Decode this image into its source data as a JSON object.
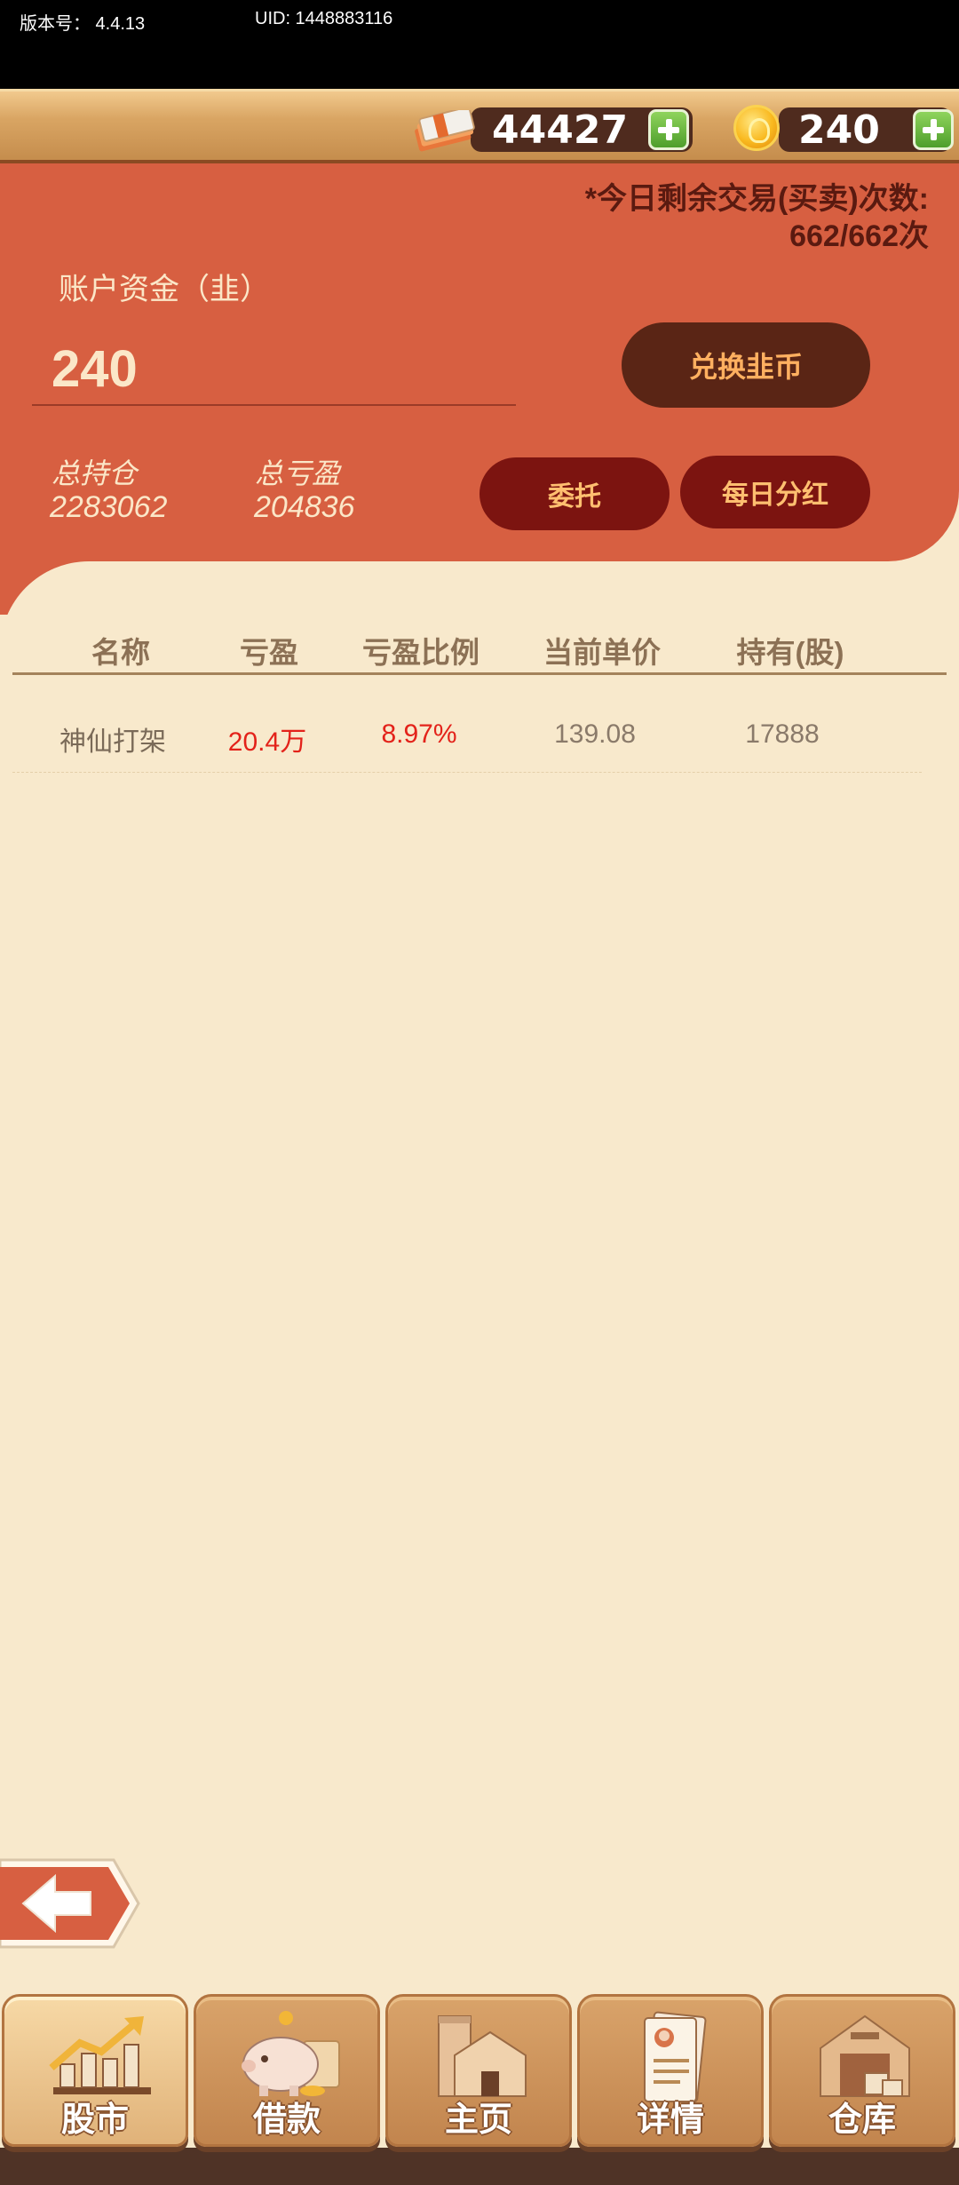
{
  "status": {
    "version": "版本号： 4.4.13",
    "uid": "UID: 1448883116"
  },
  "resources": {
    "cash": "44427",
    "coins": "240",
    "cash_icon": "cash-stack-icon",
    "coin_icon": "gold-coin-icon"
  },
  "account": {
    "trades_title": "*今日剩余交易(买卖)次数:",
    "trades_count": "662/662次",
    "fund_label": "账户资金（韭）",
    "fund_value": "240",
    "exchange_button": "兑换韭币",
    "total_position_label": "总持仓",
    "total_position_value": "2283062",
    "total_pnl_label": "总亏盈",
    "total_pnl_value": "204836",
    "entrust_button": "委托",
    "dividend_button": "每日分红"
  },
  "table": {
    "headers": [
      "名称",
      "亏盈",
      "亏盈比例",
      "当前单价",
      "持有(股)"
    ],
    "rows": [
      {
        "name": "神仙打架",
        "pnl": "20.4万",
        "pnl_ratio": "8.97%",
        "price": "139.08",
        "holdings": "17888"
      }
    ]
  },
  "nav": {
    "items": [
      {
        "label": "股市",
        "icon": "stock-chart-icon",
        "active": true
      },
      {
        "label": "借款",
        "icon": "piggy-bank-icon",
        "active": false
      },
      {
        "label": "主页",
        "icon": "home-building-icon",
        "active": false
      },
      {
        "label": "详情",
        "icon": "profile-document-icon",
        "active": false
      },
      {
        "label": "仓库",
        "icon": "warehouse-icon",
        "active": false
      }
    ]
  },
  "colors": {
    "panel": "#d75f41",
    "background": "#f8e9cc",
    "profit_red": "#e3221a",
    "button_dark": "#7c1410"
  }
}
